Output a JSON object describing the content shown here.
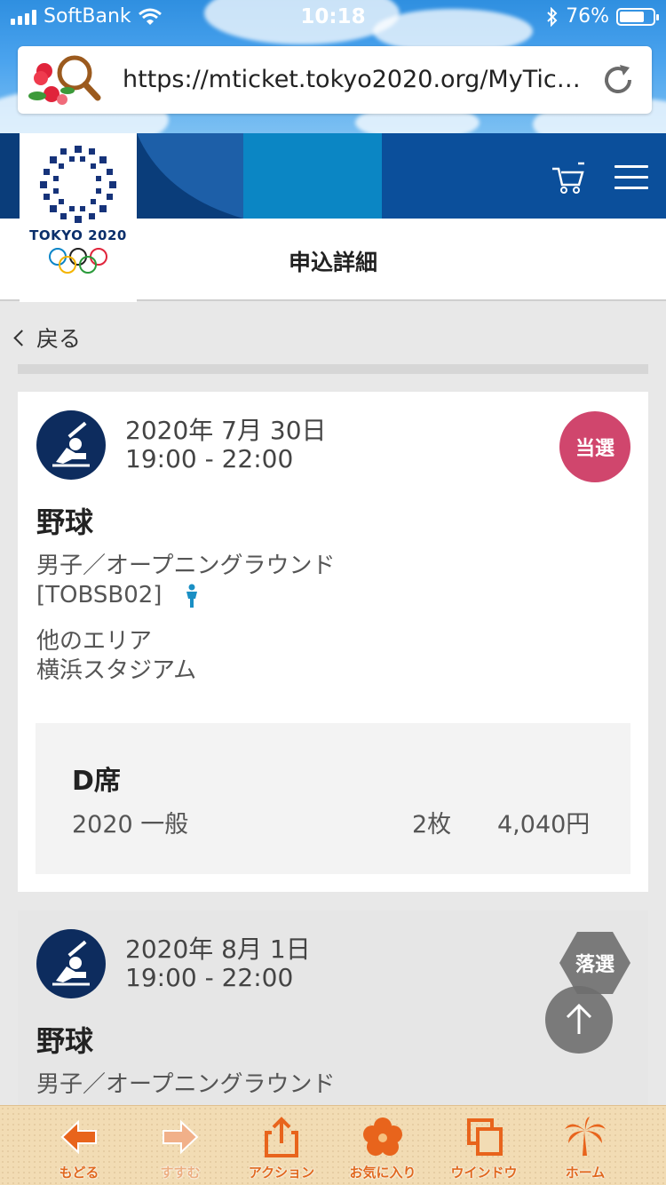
{
  "status_bar": {
    "carrier": "SoftBank",
    "time": "10:18",
    "battery_percent": "76%",
    "battery_level": 0.76
  },
  "browser": {
    "url": "https://mticket.tokyo2020.org/MyTic…"
  },
  "site": {
    "logo_text": "TOKYO 2020",
    "page_title": "申込詳細",
    "back_label": "戻る"
  },
  "cards": [
    {
      "date": "2020年 7月 30日",
      "time": "19:00 - 22:00",
      "status": "当選",
      "sport": "野球",
      "event": "男子／オープニングラウンド",
      "code": "[TOBSB02]",
      "area": "他のエリア",
      "venue": "横浜スタジアム",
      "seat": {
        "name": "D席",
        "type": "2020 一般",
        "qty": "2枚",
        "price": "4,040円"
      }
    },
    {
      "date": "2020年 8月 1日",
      "time": "19:00 - 22:00",
      "status": "落選",
      "sport": "野球",
      "event": "男子／オープニングラウンド"
    }
  ],
  "toolbar": {
    "back": "もどる",
    "forward": "すすむ",
    "action": "アクション",
    "favorites": "お気に入り",
    "window": "ウインドウ",
    "home": "ホーム"
  },
  "colors": {
    "win_badge": "#d0466d",
    "lose_badge": "#7a7a7a",
    "brand_navy": "#0d2c5e",
    "toolbar_accent": "#e0681e"
  },
  "icons": [
    "signal-icon",
    "wifi-icon",
    "bluetooth-icon",
    "battery-icon",
    "search-logo-icon",
    "reload-icon",
    "cart-icon",
    "menu-icon",
    "chevron-left-icon",
    "baseball-icon",
    "accessible-icon",
    "arrow-up-icon",
    "arrow-left-icon",
    "arrow-right-icon",
    "share-icon",
    "hibiscus-icon",
    "windows-icon",
    "palm-tree-icon"
  ]
}
